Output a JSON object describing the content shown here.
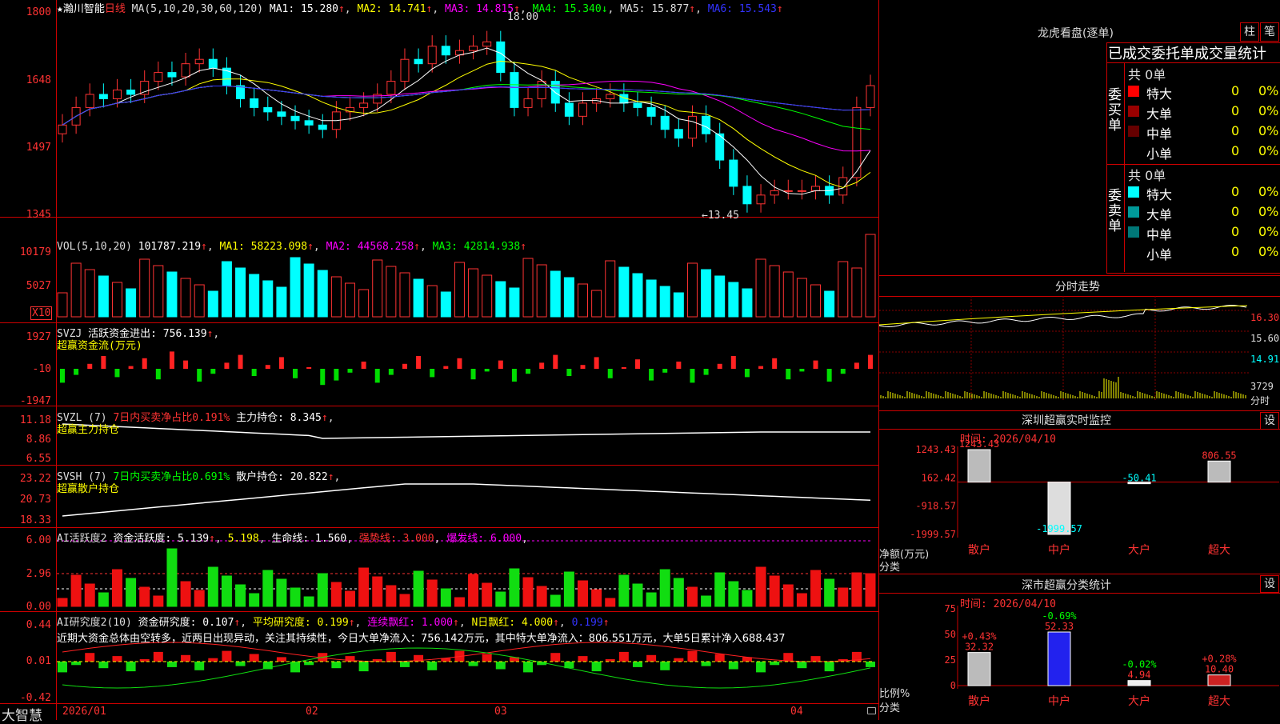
{
  "kline": {
    "stock_name": "★瀚川智能",
    "period": "日线",
    "ma_params": "MA(5,10,20,30,60,120)",
    "ma1": "MA1: 15.280",
    "ma2": "MA2: 14.741",
    "ma3": "MA3: 14.815",
    "ma4": "MA4: 15.340",
    "ma5": "MA5: 15.877",
    "ma6": "MA6: 15.543",
    "y_labels": [
      "1800",
      "1648",
      "1497",
      "1345"
    ],
    "high_mark": "18.00",
    "low_mark": "←13.45"
  },
  "vol": {
    "title": "VOL(5,10,20)",
    "value": "101787.219",
    "ma1": "MA1: 58223.098",
    "ma2": "MA2: 44568.258",
    "ma3": "MA3: 42814.938",
    "y_labels": [
      "10179",
      "5027"
    ],
    "unit": "X10"
  },
  "svzj": {
    "title": "SVZJ",
    "label": "活跃资金进出: 756.139",
    "subtitle": "超赢资金流(万元)",
    "y_labels": [
      "1927",
      "-10",
      "-1947"
    ]
  },
  "svzl": {
    "title": "SVZL (7)",
    "label1": "7日内买卖净占比0.191%",
    "label2": "主力持仓: 8.345",
    "subtitle": "超赢主力持仓",
    "y_labels": [
      "11.18",
      "8.86",
      "6.55"
    ]
  },
  "svsh": {
    "title": "SVSH (7)",
    "label1": "7日内买卖净占比0.691%",
    "label2": "散户持仓: 20.822",
    "subtitle": "超赢散户持仓",
    "y_labels": [
      "23.22",
      "20.73",
      "18.33"
    ]
  },
  "ai1": {
    "title": "AI活跃度2",
    "label1": "资金活跃度: 5.139",
    "label2": "5.198",
    "label3": "生命线: 1.560",
    "label4": "强势线: 3.000",
    "label5": "爆发线: 6.000",
    "y_labels": [
      "6.00",
      "2.96",
      "0.00"
    ]
  },
  "ai2": {
    "title": "AI研究度2(10)",
    "label1": "资金研究度: 0.107",
    "label2": "平均研究度: 0.199",
    "label3": "连续飘红: 1.000",
    "label4": "N日飘红: 4.000",
    "label5": "0.199",
    "comment": "近期大资金总体由空转多，近两日出现异动，关注其持续性，今日大单净流入：756.142万元，其中特大单净流入：806.551万元，大单5日累计净入688.437",
    "y_labels": [
      "0.44",
      "0.01",
      "-0.42"
    ]
  },
  "date_axis": {
    "brand": "大智慧",
    "labels": [
      "2026/01",
      "02",
      "03",
      "04"
    ]
  },
  "right": {
    "lhb_title": "龙虎看盘(逐单)",
    "btn_zhu": "柱",
    "btn_bi": "笔",
    "stats_header": "已成交委托单成交量统计",
    "buy_side": "委买单",
    "sell_side": "委卖单",
    "buy_total": "共 0单",
    "sell_total": "共 0单",
    "rows_buy": [
      {
        "label": "特大",
        "count": "0",
        "pct": "0%",
        "color": "#ff0000"
      },
      {
        "label": "大单",
        "count": "0",
        "pct": "0%",
        "color": "#990000"
      },
      {
        "label": "中单",
        "count": "0",
        "pct": "0%",
        "color": "#660000"
      },
      {
        "label": "小单",
        "count": "0",
        "pct": "0%",
        "color": ""
      }
    ],
    "rows_sell": [
      {
        "label": "特大",
        "count": "0",
        "pct": "0%",
        "color": "#00ffff"
      },
      {
        "label": "大单",
        "count": "0",
        "pct": "0%",
        "color": "#009999"
      },
      {
        "label": "中单",
        "count": "0",
        "pct": "0%",
        "color": "#007777"
      },
      {
        "label": "小单",
        "count": "0",
        "pct": "0%",
        "color": ""
      }
    ],
    "fenshi_title": "分时走势",
    "fenshi_labels": [
      "16.30",
      "15.60",
      "14.91"
    ],
    "fenshi_vol": "3729",
    "fenshi_unit": "分时",
    "sz_monitor_title": "深圳超赢实时监控",
    "sz_btn": "设",
    "sz_time": "时间: 2026/04/10",
    "sz_y_labels": [
      "1243.43",
      "162.42",
      "-918.57",
      "-1999.57"
    ],
    "sz_side_label1": "净额(万元)",
    "sz_side_label2": "分类",
    "sz_categories": [
      "散户",
      "中户",
      "大户",
      "超大"
    ],
    "sz_stats_title": "深市超赢分类统计",
    "sz_stats_btn": "设",
    "sz_stats_time": "时间: 2026/04/10",
    "sz_stats_y": [
      "75",
      "50",
      "25",
      "0"
    ],
    "sz_stats_side1": "比例%",
    "sz_stats_side2": "分类"
  },
  "chart_data": [
    {
      "type": "bar",
      "title": "深圳超赢实时监控",
      "categories": [
        "散户",
        "中户",
        "大户",
        "超大"
      ],
      "values": [
        1243.43,
        -1999.57,
        -50.41,
        806.55
      ],
      "value_labels": [
        "1243.43",
        "-1999.57",
        "-50.41",
        "806.55"
      ],
      "ylim": [
        -1999.57,
        1243.43
      ],
      "ylabel": "净额(万元)"
    },
    {
      "type": "bar",
      "title": "深市超赢分类统计",
      "categories": [
        "散户",
        "中户",
        "大户",
        "超大"
      ],
      "values": [
        32.32,
        52.33,
        4.94,
        10.4
      ],
      "value_labels": [
        "32.32",
        "52.33",
        "4.94",
        "10.40"
      ],
      "changes": [
        "+0.43%",
        "-0.69%",
        "-0.02%",
        "+0.28%"
      ],
      "ylim": [
        0,
        75
      ],
      "ylabel": "比例%"
    }
  ]
}
